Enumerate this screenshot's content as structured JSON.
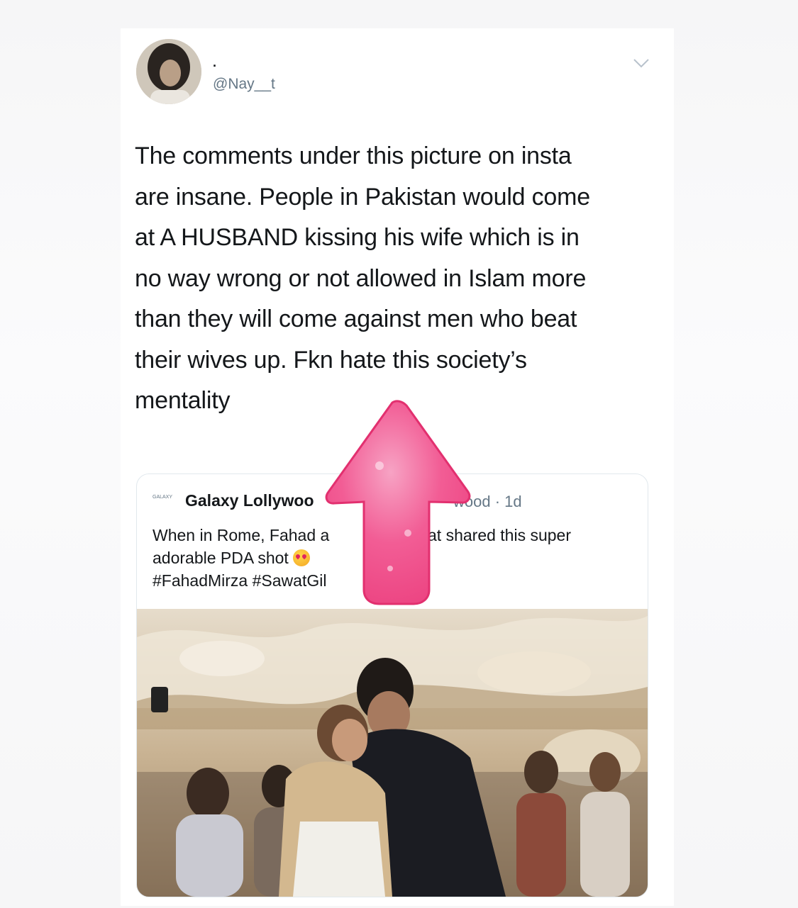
{
  "tweet": {
    "display_name": ".",
    "handle": "@Nay__t",
    "text_lines": [
      "The comments under this picture on insta",
      "are insane. People in Pakistan would come",
      "at A HUSBAND kissing his wife which is in",
      "no way wrong or not allowed in Islam more",
      "than they will come against men who beat",
      "their wives up. Fkn hate this society’s",
      "mentality"
    ],
    "menu_icon": "chevron-down-icon"
  },
  "quoted": {
    "avatar_text": "GALAXY",
    "name": "Galaxy Lollywoo",
    "meta": "wood · 1d",
    "body_row1_left": "When in Rome, Fahad a",
    "body_row1_right": "at shared this super",
    "body_row2": "adorable PDA shot",
    "body_row3": "#FahadMirza #SawatGil",
    "emoji_icon": "heart-eyes-emoji-icon"
  },
  "colors": {
    "text": "#14171a",
    "secondary": "#657786",
    "border": "#e1e8ed",
    "arrow": "#f0508a"
  }
}
